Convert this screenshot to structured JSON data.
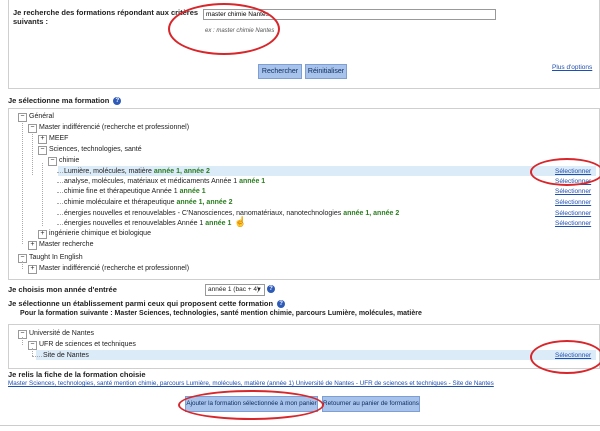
{
  "search": {
    "label": "Je recherche des formations répondant aux critères suivants :",
    "input_value": "master chimie Nantes",
    "example": "ex : master chimie Nantes",
    "search_button": "Rechercher",
    "reset_button": "Réinitialiser",
    "more_options": "Plus d'options"
  },
  "formation": {
    "heading": "Je sélectionne ma formation",
    "tree": {
      "general": "Général",
      "master_indiff": "Master indifférencié (recherche et professionnel)",
      "meef": "MEEF",
      "sciences": "Sciences, technologies, santé",
      "chimie": "chimie",
      "items": [
        {
          "label": "Lumière, molécules, matière",
          "years": "année 1, année 2",
          "select": "Sélectionner"
        },
        {
          "label": "analyse, molécules, matériaux et médicaments Année 1",
          "years": "année 1",
          "select": "Sélectionner"
        },
        {
          "label": "chimie fine et thérapeutique Année 1",
          "years": "année 1",
          "select": "Sélectionner"
        },
        {
          "label": "chimie moléculaire et thérapeutique",
          "years": "année 1, année 2",
          "select": "Sélectionner"
        },
        {
          "label": "énergies nouvelles et renouvelables - C'Nanosciences, nanomatériaux, nanotechnologies",
          "years": "année 1, année 2",
          "select": "Sélectionner"
        },
        {
          "label": "énergies nouvelles et renouvelables Année 1",
          "years": "année 1",
          "select": "Sélectionner"
        }
      ],
      "ingenierie": "ingénierie chimique et biologique",
      "master_recherche": "Master recherche",
      "taught_english": "Taught In English",
      "master_indiff2": "Master indifférencié (recherche et professionnel)"
    }
  },
  "annee": {
    "label": "Je choisis mon année d'entrée",
    "selected": "année 1 (bac + 4)"
  },
  "etablissement": {
    "heading": "Je sélectionne un établissement parmi ceux qui proposent cette formation",
    "pour_label": "Pour la formation suivante : Master Sciences, technologies, santé mention chimie, parcours Lumière, molécules, matière",
    "universite": "Université de Nantes",
    "ufr": "UFR de sciences et techniques",
    "site": "Site de Nantes",
    "select": "Sélectionner"
  },
  "fiche": {
    "heading": "Je relis la fiche de la formation choisie",
    "link": "Master Sciences, technologies, santé mention chimie, parcours Lumière, molécules, matière (année 1) Université de Nantes - UFR de sciences et techniques - Site de Nantes"
  },
  "actions": {
    "add": "Ajouter la formation sélectionnée à mon panier",
    "back": "Retourner au panier de formations"
  },
  "colors": {
    "accent": "#2e5ab8",
    "highlight": "#dcebf8",
    "annotation": "#d8262b",
    "year_green": "#2a7d1f"
  },
  "icons": [
    "help-icon",
    "dropdown-arrow-icon",
    "cursor-hand-icon"
  ]
}
